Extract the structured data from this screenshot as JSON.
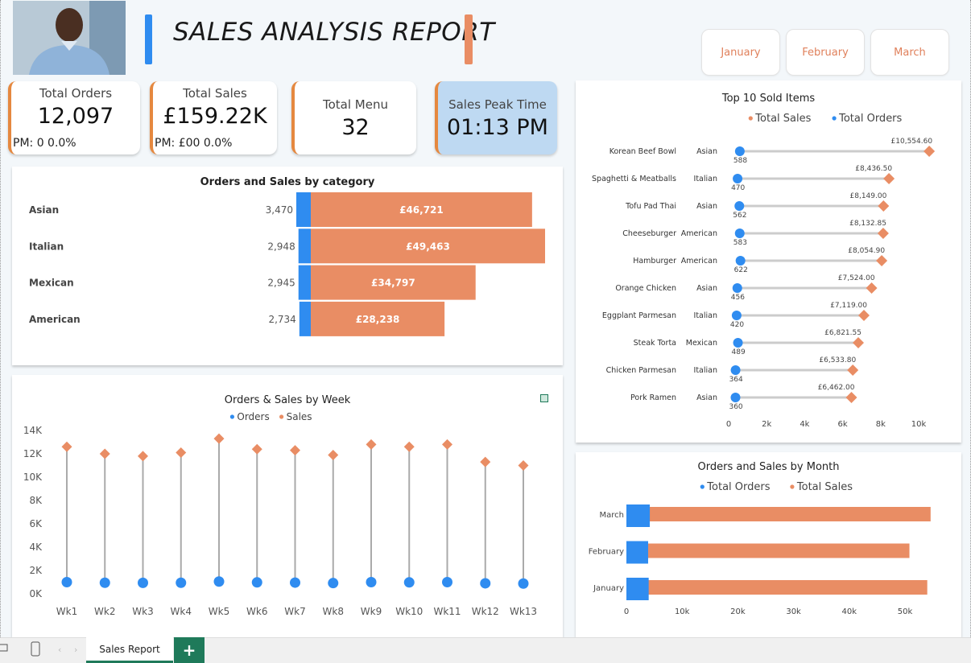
{
  "header": {
    "title": "SALES ANALYSIS REPORT",
    "months": [
      "January",
      "February",
      "March"
    ]
  },
  "kpis": {
    "total_orders": {
      "label": "Total Orders",
      "value": "12,097",
      "pm": "PM: 0 0.0%"
    },
    "total_sales": {
      "label": "Total Sales",
      "value": "£159.22K",
      "pm": "PM: £00 0.0%"
    },
    "total_menu": {
      "label": "Total Menu",
      "value": "32"
    },
    "peak_time": {
      "label": "Sales Peak Time",
      "value": "01:13 PM"
    }
  },
  "colors": {
    "orders": "#2f8cf0",
    "sales": "#e98d64",
    "peak_bg": "#bed9f2",
    "kpi_accent": "#e5883f"
  },
  "tabs": {
    "active": "Sales Report",
    "add": "+"
  },
  "chart_data": [
    {
      "id": "category",
      "type": "bar",
      "title": "Orders and Sales by category",
      "categories": [
        "Asian",
        "Italian",
        "Mexican",
        "American"
      ],
      "series": [
        {
          "name": "Orders",
          "values": [
            3470,
            2948,
            2945,
            2734
          ],
          "labels": [
            "3,470",
            "2,948",
            "2,945",
            "2,734"
          ]
        },
        {
          "name": "Sales",
          "values": [
            46721,
            49463,
            34797,
            28238
          ],
          "labels": [
            "£46,721",
            "£49,463",
            "£34,797",
            "£28,238"
          ]
        }
      ]
    },
    {
      "id": "week",
      "type": "line",
      "title": "Orders & Sales by Week",
      "legend": [
        "Orders",
        "Sales"
      ],
      "categories": [
        "Wk1",
        "Wk2",
        "Wk3",
        "Wk4",
        "Wk5",
        "Wk6",
        "Wk7",
        "Wk8",
        "Wk9",
        "Wk10",
        "Wk11",
        "Wk12",
        "Wk13"
      ],
      "series": [
        {
          "name": "Orders",
          "values": [
            1000,
            950,
            940,
            950,
            1050,
            980,
            960,
            920,
            1000,
            980,
            1000,
            900,
            880
          ]
        },
        {
          "name": "Sales",
          "values": [
            12600,
            12000,
            11800,
            12100,
            13300,
            12400,
            12300,
            11900,
            12800,
            12600,
            12800,
            11300,
            11000
          ]
        }
      ],
      "yticks": [
        "0K",
        "2K",
        "4K",
        "6K",
        "8K",
        "10K",
        "12K",
        "14K"
      ],
      "ylim": [
        0,
        14000
      ]
    },
    {
      "id": "top10",
      "type": "scatter",
      "title": "Top 10 Sold Items",
      "legend": [
        "Total Sales",
        "Total Orders"
      ],
      "items": [
        {
          "name": "Korean Beef Bowl",
          "category": "Asian",
          "sales": 10554.6,
          "sales_label": "£10,554.60",
          "orders": 588
        },
        {
          "name": "Spaghetti & Meatballs",
          "category": "Italian",
          "sales": 8436.5,
          "sales_label": "£8,436.50",
          "orders": 470
        },
        {
          "name": "Tofu Pad Thai",
          "category": "Asian",
          "sales": 8149.0,
          "sales_label": "£8,149.00",
          "orders": 562
        },
        {
          "name": "Cheeseburger",
          "category": "American",
          "sales": 8132.85,
          "sales_label": "£8,132.85",
          "orders": 583
        },
        {
          "name": "Hamburger",
          "category": "American",
          "sales": 8054.9,
          "sales_label": "£8,054.90",
          "orders": 622
        },
        {
          "name": "Orange Chicken",
          "category": "Asian",
          "sales": 7524.0,
          "sales_label": "£7,524.00",
          "orders": 456
        },
        {
          "name": "Eggplant Parmesan",
          "category": "Italian",
          "sales": 7119.0,
          "sales_label": "£7,119.00",
          "orders": 420
        },
        {
          "name": "Steak Torta",
          "category": "Mexican",
          "sales": 6821.55,
          "sales_label": "£6,821.55",
          "orders": 489
        },
        {
          "name": "Chicken Parmesan",
          "category": "Italian",
          "sales": 6533.8,
          "sales_label": "£6,533.80",
          "orders": 364
        },
        {
          "name": "Pork Ramen",
          "category": "Asian",
          "sales": 6462.0,
          "sales_label": "£6,462.00",
          "orders": 360
        }
      ],
      "xticks": [
        "0",
        "2k",
        "4k",
        "6k",
        "8k",
        "10k"
      ],
      "xlim": [
        0,
        11000
      ]
    },
    {
      "id": "month",
      "type": "bar",
      "title": "Orders and Sales by Month",
      "legend": [
        "Total Orders",
        "Total Sales"
      ],
      "categories": [
        "March",
        "February",
        "January"
      ],
      "series": [
        {
          "name": "Total Orders",
          "values": [
            4200,
            3900,
            4000
          ]
        },
        {
          "name": "Total Sales",
          "values": [
            54600,
            50800,
            54000
          ]
        }
      ],
      "xticks": [
        "0",
        "10k",
        "20k",
        "30k",
        "40k",
        "50k"
      ],
      "xlim": [
        0,
        50000
      ]
    }
  ]
}
